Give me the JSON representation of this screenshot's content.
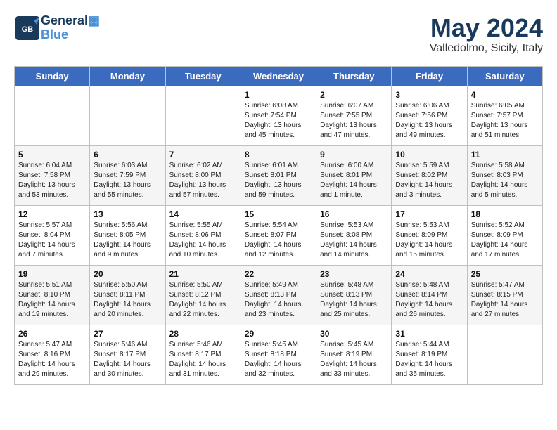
{
  "header": {
    "logo_general": "General",
    "logo_blue": "Blue",
    "month": "May 2024",
    "location": "Valledolmo, Sicily, Italy"
  },
  "weekdays": [
    "Sunday",
    "Monday",
    "Tuesday",
    "Wednesday",
    "Thursday",
    "Friday",
    "Saturday"
  ],
  "weeks": [
    [
      {
        "day": "",
        "text": ""
      },
      {
        "day": "",
        "text": ""
      },
      {
        "day": "",
        "text": ""
      },
      {
        "day": "1",
        "text": "Sunrise: 6:08 AM\nSunset: 7:54 PM\nDaylight: 13 hours\nand 45 minutes."
      },
      {
        "day": "2",
        "text": "Sunrise: 6:07 AM\nSunset: 7:55 PM\nDaylight: 13 hours\nand 47 minutes."
      },
      {
        "day": "3",
        "text": "Sunrise: 6:06 AM\nSunset: 7:56 PM\nDaylight: 13 hours\nand 49 minutes."
      },
      {
        "day": "4",
        "text": "Sunrise: 6:05 AM\nSunset: 7:57 PM\nDaylight: 13 hours\nand 51 minutes."
      }
    ],
    [
      {
        "day": "5",
        "text": "Sunrise: 6:04 AM\nSunset: 7:58 PM\nDaylight: 13 hours\nand 53 minutes."
      },
      {
        "day": "6",
        "text": "Sunrise: 6:03 AM\nSunset: 7:59 PM\nDaylight: 13 hours\nand 55 minutes."
      },
      {
        "day": "7",
        "text": "Sunrise: 6:02 AM\nSunset: 8:00 PM\nDaylight: 13 hours\nand 57 minutes."
      },
      {
        "day": "8",
        "text": "Sunrise: 6:01 AM\nSunset: 8:01 PM\nDaylight: 13 hours\nand 59 minutes."
      },
      {
        "day": "9",
        "text": "Sunrise: 6:00 AM\nSunset: 8:01 PM\nDaylight: 14 hours\nand 1 minute."
      },
      {
        "day": "10",
        "text": "Sunrise: 5:59 AM\nSunset: 8:02 PM\nDaylight: 14 hours\nand 3 minutes."
      },
      {
        "day": "11",
        "text": "Sunrise: 5:58 AM\nSunset: 8:03 PM\nDaylight: 14 hours\nand 5 minutes."
      }
    ],
    [
      {
        "day": "12",
        "text": "Sunrise: 5:57 AM\nSunset: 8:04 PM\nDaylight: 14 hours\nand 7 minutes."
      },
      {
        "day": "13",
        "text": "Sunrise: 5:56 AM\nSunset: 8:05 PM\nDaylight: 14 hours\nand 9 minutes."
      },
      {
        "day": "14",
        "text": "Sunrise: 5:55 AM\nSunset: 8:06 PM\nDaylight: 14 hours\nand 10 minutes."
      },
      {
        "day": "15",
        "text": "Sunrise: 5:54 AM\nSunset: 8:07 PM\nDaylight: 14 hours\nand 12 minutes."
      },
      {
        "day": "16",
        "text": "Sunrise: 5:53 AM\nSunset: 8:08 PM\nDaylight: 14 hours\nand 14 minutes."
      },
      {
        "day": "17",
        "text": "Sunrise: 5:53 AM\nSunset: 8:09 PM\nDaylight: 14 hours\nand 15 minutes."
      },
      {
        "day": "18",
        "text": "Sunrise: 5:52 AM\nSunset: 8:09 PM\nDaylight: 14 hours\nand 17 minutes."
      }
    ],
    [
      {
        "day": "19",
        "text": "Sunrise: 5:51 AM\nSunset: 8:10 PM\nDaylight: 14 hours\nand 19 minutes."
      },
      {
        "day": "20",
        "text": "Sunrise: 5:50 AM\nSunset: 8:11 PM\nDaylight: 14 hours\nand 20 minutes."
      },
      {
        "day": "21",
        "text": "Sunrise: 5:50 AM\nSunset: 8:12 PM\nDaylight: 14 hours\nand 22 minutes."
      },
      {
        "day": "22",
        "text": "Sunrise: 5:49 AM\nSunset: 8:13 PM\nDaylight: 14 hours\nand 23 minutes."
      },
      {
        "day": "23",
        "text": "Sunrise: 5:48 AM\nSunset: 8:13 PM\nDaylight: 14 hours\nand 25 minutes."
      },
      {
        "day": "24",
        "text": "Sunrise: 5:48 AM\nSunset: 8:14 PM\nDaylight: 14 hours\nand 26 minutes."
      },
      {
        "day": "25",
        "text": "Sunrise: 5:47 AM\nSunset: 8:15 PM\nDaylight: 14 hours\nand 27 minutes."
      }
    ],
    [
      {
        "day": "26",
        "text": "Sunrise: 5:47 AM\nSunset: 8:16 PM\nDaylight: 14 hours\nand 29 minutes."
      },
      {
        "day": "27",
        "text": "Sunrise: 5:46 AM\nSunset: 8:17 PM\nDaylight: 14 hours\nand 30 minutes."
      },
      {
        "day": "28",
        "text": "Sunrise: 5:46 AM\nSunset: 8:17 PM\nDaylight: 14 hours\nand 31 minutes."
      },
      {
        "day": "29",
        "text": "Sunrise: 5:45 AM\nSunset: 8:18 PM\nDaylight: 14 hours\nand 32 minutes."
      },
      {
        "day": "30",
        "text": "Sunrise: 5:45 AM\nSunset: 8:19 PM\nDaylight: 14 hours\nand 33 minutes."
      },
      {
        "day": "31",
        "text": "Sunrise: 5:44 AM\nSunset: 8:19 PM\nDaylight: 14 hours\nand 35 minutes."
      },
      {
        "day": "",
        "text": ""
      }
    ]
  ]
}
